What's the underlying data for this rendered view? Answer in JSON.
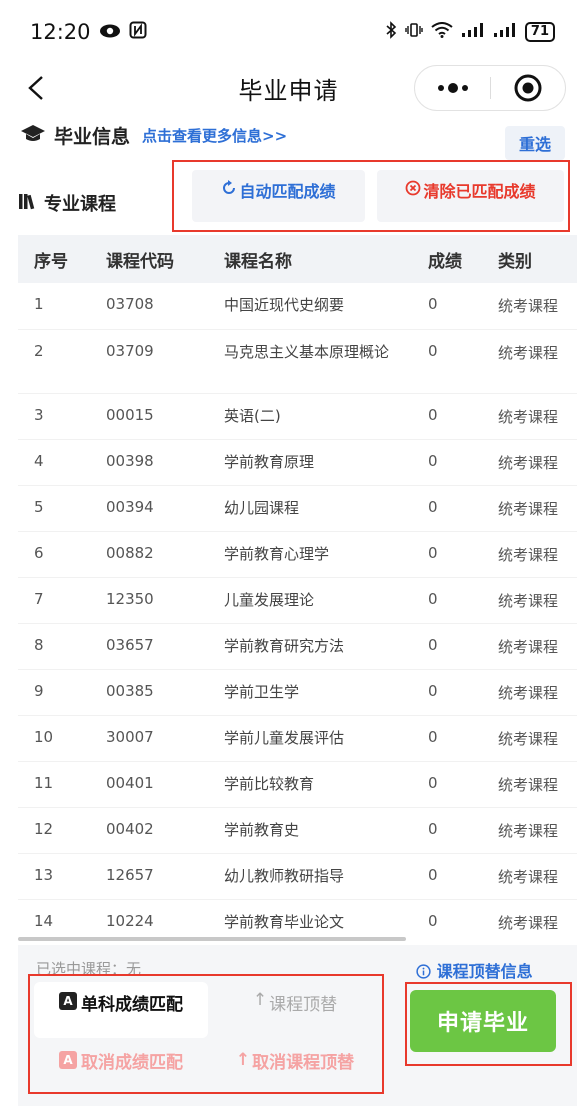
{
  "status_bar": {
    "time": "12:20",
    "battery": "71"
  },
  "nav": {
    "title": "毕业申请"
  },
  "graduation": {
    "title": "毕业信息",
    "more_link": "点击查看更多信息>>",
    "reselect": "重选"
  },
  "courses": {
    "title": "专业课程",
    "auto_match": "自动匹配成绩",
    "clear_match": "清除已匹配成绩",
    "headers": [
      "序号",
      "课程代码",
      "课程名称",
      "成绩",
      "类别"
    ],
    "rows": [
      {
        "no": "1",
        "code": "03708",
        "name": "中国近现代史纲要",
        "score": "0",
        "type": "统考课程"
      },
      {
        "no": "2",
        "code": "03709",
        "name": "马克思主义基本原理概论",
        "score": "0",
        "type": "统考课程"
      },
      {
        "no": "3",
        "code": "00015",
        "name": "英语(二)",
        "score": "0",
        "type": "统考课程"
      },
      {
        "no": "4",
        "code": "00398",
        "name": "学前教育原理",
        "score": "0",
        "type": "统考课程"
      },
      {
        "no": "5",
        "code": "00394",
        "name": "幼儿园课程",
        "score": "0",
        "type": "统考课程"
      },
      {
        "no": "6",
        "code": "00882",
        "name": "学前教育心理学",
        "score": "0",
        "type": "统考课程"
      },
      {
        "no": "7",
        "code": "12350",
        "name": "儿童发展理论",
        "score": "0",
        "type": "统考课程"
      },
      {
        "no": "8",
        "code": "03657",
        "name": "学前教育研究方法",
        "score": "0",
        "type": "统考课程"
      },
      {
        "no": "9",
        "code": "00385",
        "name": "学前卫生学",
        "score": "0",
        "type": "统考课程"
      },
      {
        "no": "10",
        "code": "30007",
        "name": "学前儿童发展评估",
        "score": "0",
        "type": "统考课程"
      },
      {
        "no": "11",
        "code": "00401",
        "name": "学前比较教育",
        "score": "0",
        "type": "统考课程"
      },
      {
        "no": "12",
        "code": "00402",
        "name": "学前教育史",
        "score": "0",
        "type": "统考课程"
      },
      {
        "no": "13",
        "code": "12657",
        "name": "幼儿教师教研指导",
        "score": "0",
        "type": "统考课程"
      },
      {
        "no": "14",
        "code": "10224",
        "name": "学前教育毕业论文",
        "score": "0",
        "type": "统考课程"
      }
    ]
  },
  "bottom": {
    "selected": "已选中课程：无",
    "replace_info": "课程顶替信息",
    "single_match": "单科成绩匹配",
    "course_replace": "课程顶替",
    "cancel_match": "取消成绩匹配",
    "cancel_replace": "取消课程顶替",
    "apply": "申请毕业"
  }
}
